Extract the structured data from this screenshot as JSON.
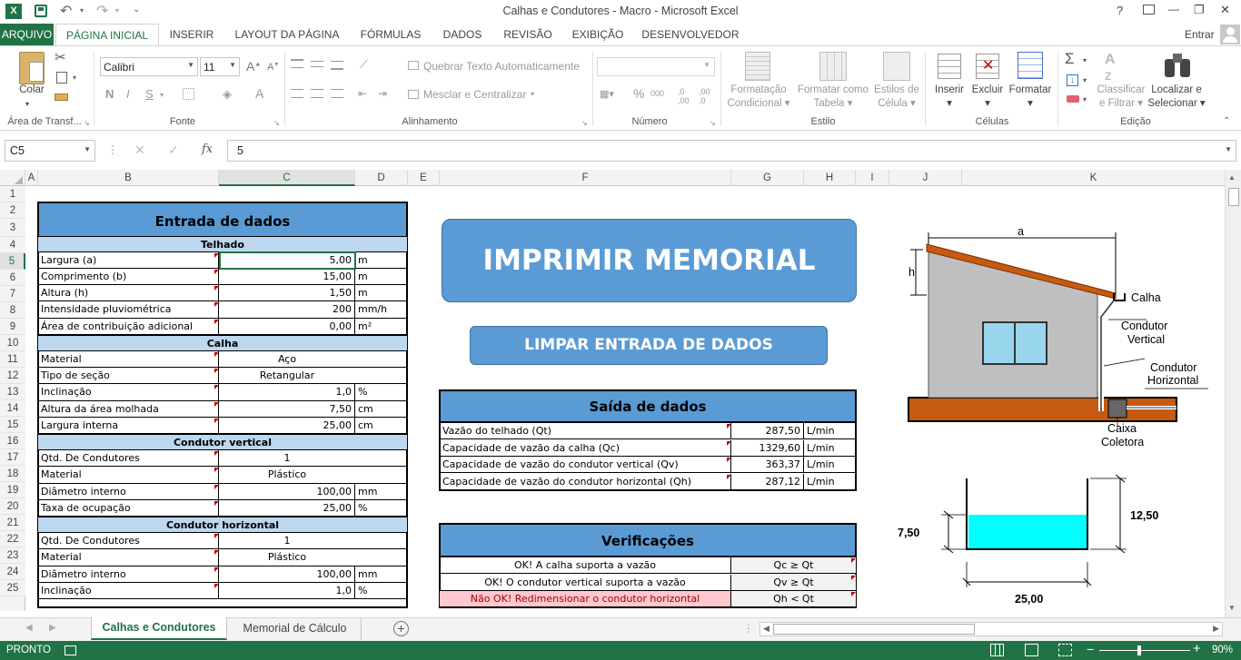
{
  "title": "Calhas e Condutores - Macro - Microsoft Excel",
  "window": {
    "help": "?",
    "minimize": "—",
    "restore": "❐",
    "close": "✕"
  },
  "tabs": [
    "ARQUIVO",
    "PÁGINA INICIAL",
    "INSERIR",
    "LAYOUT DA PÁGINA",
    "FÓRMULAS",
    "DADOS",
    "REVISÃO",
    "EXIBIÇÃO",
    "DESENVOLVEDOR"
  ],
  "user": "Entrar",
  "ribbon": {
    "paste": "Colar",
    "clipboard_group": "Área de Transf...",
    "font_name": "Calibri",
    "font_size": "11",
    "bold": "N",
    "italic": "I",
    "underline": "S",
    "font_group": "Fonte",
    "wrap_text": "Quebrar Texto Automaticamente",
    "merge_center": "Mesclar e Centralizar",
    "alignment_group": "Alinhamento",
    "number_group": "Número",
    "cond_format_1": "Formatação",
    "cond_format_2": "Condicional",
    "format_table_1": "Formatar como",
    "format_table_2": "Tabela",
    "cell_styles_1": "Estilos de",
    "cell_styles_2": "Célula",
    "styles_group": "Estilo",
    "insert": "Inserir",
    "delete": "Excluir",
    "format": "Formatar",
    "cells_group": "Células",
    "sort_1": "Classificar",
    "sort_2": "e Filtrar",
    "find_1": "Localizar e",
    "find_2": "Selecionar",
    "editing_group": "Edição",
    "percent": "%",
    "thousands": "000"
  },
  "formula_bar": {
    "name_box": "C5",
    "fx": "fx",
    "value": "5"
  },
  "columns": [
    "A",
    "B",
    "C",
    "D",
    "E",
    "F",
    "G",
    "H",
    "I",
    "J",
    "K"
  ],
  "rows": [
    "1",
    "2",
    "3",
    "4",
    "5",
    "6",
    "7",
    "8",
    "9",
    "10",
    "11",
    "12",
    "13",
    "14",
    "15",
    "16",
    "17",
    "18",
    "19",
    "20",
    "21",
    "22",
    "23",
    "24",
    "25"
  ],
  "input": {
    "title": "Entrada de dados",
    "roof_title": "Telhado",
    "roof": [
      {
        "label": "Largura (a)",
        "value": "5,00",
        "unit": "m"
      },
      {
        "label": "Comprimento (b)",
        "value": "15,00",
        "unit": "m"
      },
      {
        "label": "Altura (h)",
        "value": "1,50",
        "unit": "m"
      },
      {
        "label": "Intensidade pluviométrica",
        "value": "200",
        "unit": "mm/h"
      },
      {
        "label": "Área de contribuição adicional",
        "value": "0,00",
        "unit": "m²"
      }
    ],
    "gutter_title": "Calha",
    "gutter": [
      {
        "label": "Material",
        "value": "Aço",
        "unit": ""
      },
      {
        "label": "Tipo de seção",
        "value": "Retangular",
        "unit": ""
      },
      {
        "label": "Inclinação",
        "value": "1,0",
        "unit": "%"
      },
      {
        "label": "Altura da área molhada",
        "value": "7,50",
        "unit": "cm"
      },
      {
        "label": "Largura interna",
        "value": "25,00",
        "unit": "cm"
      }
    ],
    "vertical_title": "Condutor vertical",
    "vertical": [
      {
        "label": "Qtd. De Condutores",
        "value": "1",
        "unit": ""
      },
      {
        "label": "Material",
        "value": "Plástico",
        "unit": ""
      },
      {
        "label": "Diâmetro interno",
        "value": "100,00",
        "unit": "mm"
      },
      {
        "label": "Taxa de ocupação",
        "value": "25,00",
        "unit": "%"
      }
    ],
    "horizontal_title": "Condutor horizontal",
    "horizontal": [
      {
        "label": "Qtd. De Condutores",
        "value": "1",
        "unit": ""
      },
      {
        "label": "Material",
        "value": "Plástico",
        "unit": ""
      },
      {
        "label": "Diâmetro interno",
        "value": "100,00",
        "unit": "mm"
      },
      {
        "label": "Inclinação",
        "value": "1,0",
        "unit": "%"
      }
    ]
  },
  "buttons": {
    "print": "IMPRIMIR MEMORIAL",
    "clear": "LIMPAR ENTRADA DE DADOS"
  },
  "output": {
    "title": "Saída de dados",
    "rows": [
      {
        "label": "Vazão do telhado (Qt)",
        "value": "287,50",
        "unit": "L/min"
      },
      {
        "label": "Capacidade de vazão da calha (Qc)",
        "value": "1329,60",
        "unit": "L/min"
      },
      {
        "label": "Capacidade de vazão do condutor vertical (Qv)",
        "value": "363,37",
        "unit": "L/min"
      },
      {
        "label": "Capacidade de vazão do condutor horizontal (Qh)",
        "value": "287,12",
        "unit": "L/min"
      }
    ]
  },
  "checks": {
    "title": "Verificações",
    "rows": [
      {
        "text": "OK! A calha suporta a vazão",
        "cond": "Qc ≥ Qt",
        "ok": true
      },
      {
        "text": "OK! O condutor vertical suporta a vazão",
        "cond": "Qv ≥ Qt",
        "ok": true
      },
      {
        "text": "Não OK! Redimensionar o condutor horizontal",
        "cond": "Qh < Qt",
        "ok": false
      }
    ]
  },
  "house": {
    "a": "a",
    "h": "h",
    "gutter": "Calha",
    "vertical_1": "Condutor",
    "vertical_2": "Vertical",
    "horizontal_1": "Condutor",
    "horizontal_2": "Horizontal",
    "box_1": "Caixa",
    "box_2": "Coletora"
  },
  "section": {
    "left": "7,50",
    "right": "12,50",
    "bottom": "25,00"
  },
  "sheets": [
    "Calhas e Condutores",
    "Memorial de Cálculo"
  ],
  "status": {
    "mode": "PRONTO",
    "zoom": "90%"
  },
  "colors": {
    "excel_green": "#217346",
    "header_blue": "#5b9bd5",
    "section_blue": "#bdd7ee",
    "error_pink": "#ffc7ce",
    "error_text": "#9c0006",
    "water": "#00ffff",
    "wall": "#bfbfbf",
    "roof": "#c55a11"
  }
}
